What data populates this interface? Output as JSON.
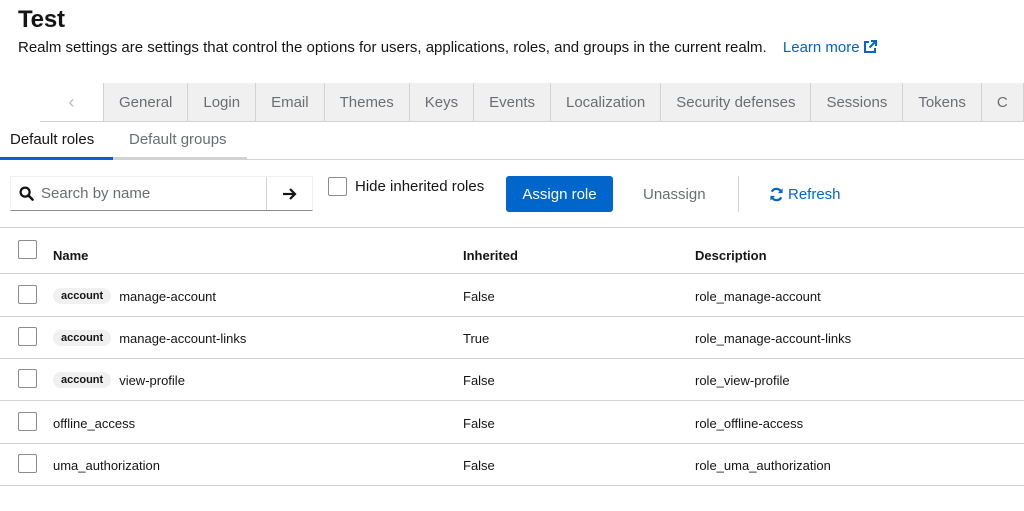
{
  "page": {
    "title": "Test",
    "subtitle": "Realm settings are settings that control the options for users, applications, roles, and groups in the current realm.",
    "learn_more": "Learn more"
  },
  "tabs": [
    "General",
    "Login",
    "Email",
    "Themes",
    "Keys",
    "Events",
    "Localization",
    "Security defenses",
    "Sessions",
    "Tokens",
    "C"
  ],
  "subtabs": {
    "default_roles": "Default roles",
    "default_groups": "Default groups"
  },
  "toolbar": {
    "search_placeholder": "Search by name",
    "hide_inherited_label": "Hide inherited roles",
    "assign_label": "Assign role",
    "unassign_label": "Unassign",
    "refresh_label": "Refresh"
  },
  "table": {
    "headers": {
      "name": "Name",
      "inherited": "Inherited",
      "description": "Description"
    },
    "rows": [
      {
        "client": "account",
        "name": "manage-account",
        "inherited": "False",
        "description": "role_manage-account"
      },
      {
        "client": "account",
        "name": "manage-account-links",
        "inherited": "True",
        "description": "role_manage-account-links"
      },
      {
        "client": "account",
        "name": "view-profile",
        "inherited": "False",
        "description": "role_view-profile"
      },
      {
        "client": "",
        "name": "offline_access",
        "inherited": "False",
        "description": "role_offline-access"
      },
      {
        "client": "",
        "name": "uma_authorization",
        "inherited": "False",
        "description": "role_uma_authorization"
      }
    ]
  },
  "colors": {
    "accent": "#0066cc",
    "border": "#d2d2d2",
    "muted_text": "#6a6e73"
  }
}
